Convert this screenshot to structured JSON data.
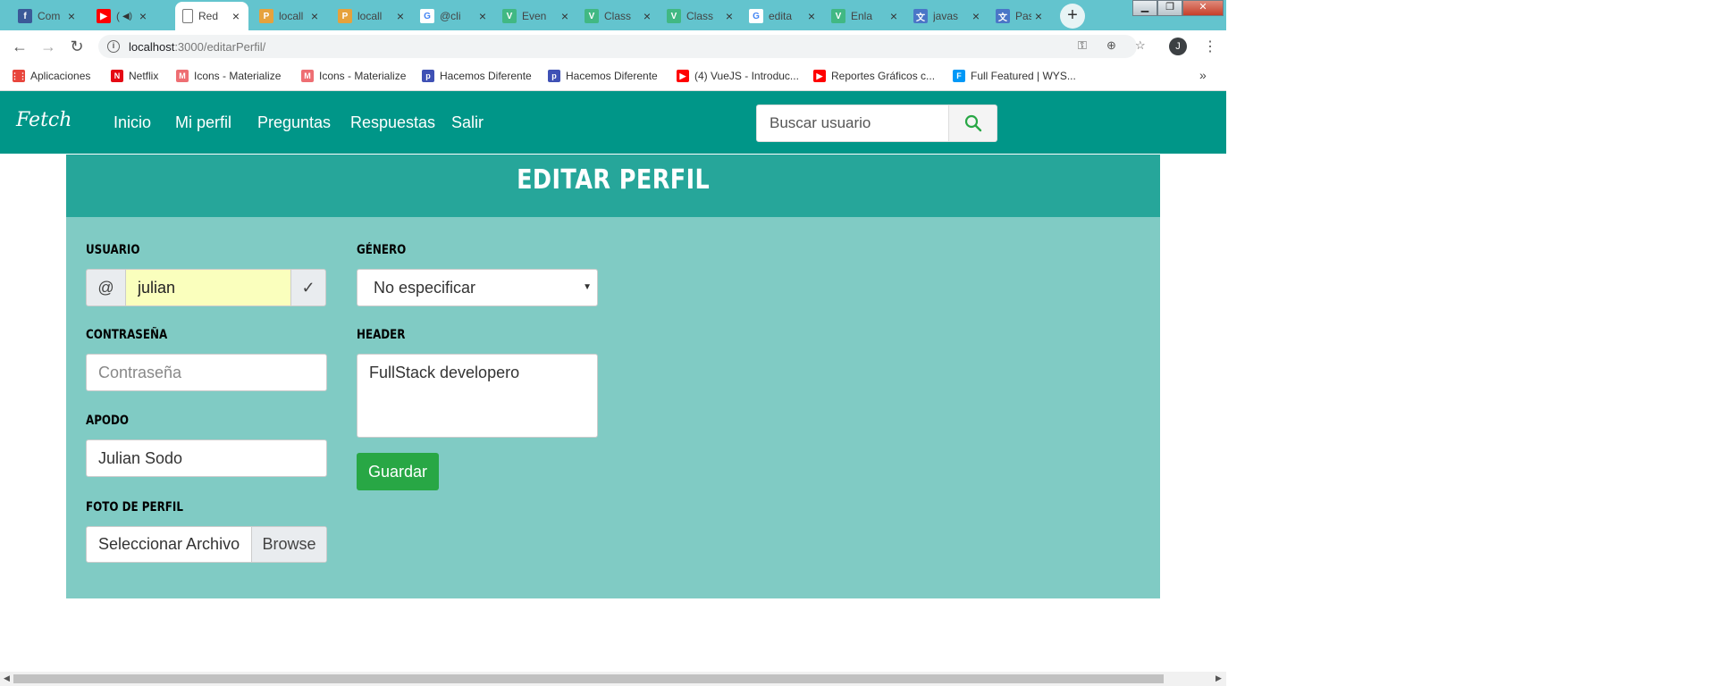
{
  "tabs": [
    {
      "title": "Com",
      "icon": "facebook-icon",
      "color": "#3b5998",
      "glyph": "f"
    },
    {
      "title": "(",
      "icon": "youtube-icon",
      "color": "#ff0000",
      "glyph": "▶",
      "audio": "◀)"
    },
    {
      "title": "Red",
      "icon": "page-icon",
      "color": "#ffffff",
      "glyph": ""
    },
    {
      "title": "locall",
      "icon": "phpmyadmin-icon",
      "color": "#e6a23c",
      "glyph": "P"
    },
    {
      "title": "locall",
      "icon": "phpmyadmin-icon",
      "color": "#e6a23c",
      "glyph": "P"
    },
    {
      "title": "@cli",
      "icon": "google-icon",
      "color": "#ffffff",
      "glyph": "G"
    },
    {
      "title": "Even",
      "icon": "vue-icon",
      "color": "#41b883",
      "glyph": "V"
    },
    {
      "title": "Class",
      "icon": "vue-icon",
      "color": "#41b883",
      "glyph": "V"
    },
    {
      "title": "Class",
      "icon": "vue-icon",
      "color": "#41b883",
      "glyph": "V"
    },
    {
      "title": "edita",
      "icon": "google-icon",
      "color": "#ffffff",
      "glyph": "G"
    },
    {
      "title": "Enla",
      "icon": "vue-icon",
      "color": "#41b883",
      "glyph": "V"
    },
    {
      "title": "javas",
      "icon": "translate-icon",
      "color": "#4a76c7",
      "glyph": "文"
    },
    {
      "title": "Pasa",
      "icon": "translate-icon",
      "color": "#4a76c7",
      "glyph": "文"
    }
  ],
  "address": {
    "host": "localhost",
    "path": ":3000/editarPerfil/"
  },
  "profile_initial": "J",
  "bookmarks": [
    {
      "label": "Aplicaciones",
      "icon": "apps-grid-icon",
      "color": "#e8453c",
      "glyph": "⋮⋮"
    },
    {
      "label": "Netflix",
      "icon": "netflix-icon",
      "color": "#e50914",
      "glyph": "N"
    },
    {
      "label": "Icons - Materialize",
      "icon": "materialize-icon",
      "color": "#ee6e73",
      "glyph": "M"
    },
    {
      "label": "Icons - Materialize",
      "icon": "materialize-icon",
      "color": "#ee6e73",
      "glyph": "M"
    },
    {
      "label": "Hacemos Diferente",
      "icon": "hacemos-icon",
      "color": "#3f51b5",
      "glyph": "p"
    },
    {
      "label": "Hacemos Diferente",
      "icon": "hacemos-icon",
      "color": "#3f51b5",
      "glyph": "p"
    },
    {
      "label": "(4) VueJS - Introduc...",
      "icon": "youtube-icon",
      "color": "#ff0000",
      "glyph": "▶"
    },
    {
      "label": "Reportes Gráficos c...",
      "icon": "youtube-icon",
      "color": "#ff0000",
      "glyph": "▶"
    },
    {
      "label": "Full Featured | WYS...",
      "icon": "froala-icon",
      "color": "#0098f7",
      "glyph": "F"
    }
  ],
  "navbar": {
    "brand": "Fetch",
    "links": [
      "Inicio",
      "Mi perfil",
      "Preguntas",
      "Respuestas",
      "Salir"
    ],
    "search_placeholder": "Buscar usuario"
  },
  "form": {
    "title": "EDITAR PERFIL",
    "usuario_label": "USUARIO",
    "usuario_prefix": "@",
    "usuario_value": "julian",
    "usuario_suffix": "✓",
    "contrasena_label": "CONTRASEÑA",
    "contrasena_placeholder": "Contraseña",
    "apodo_label": "APODO",
    "apodo_value": "Julian Sodo",
    "foto_label": "FOTO DE PERFIL",
    "foto_placeholder": "Seleccionar Archivo",
    "foto_browse": "Browse",
    "genero_label": "GÉNERO",
    "genero_value": "No especificar",
    "header_label": "HEADER",
    "header_value": "FullStack developero",
    "save_label": "Guardar"
  },
  "colors": {
    "navbar": "#009688",
    "card_header": "#26a69a",
    "card": "#80cbc4",
    "save": "#28a745"
  }
}
